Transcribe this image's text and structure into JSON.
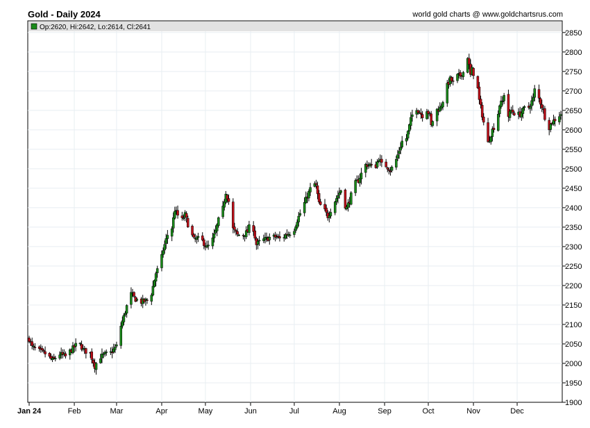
{
  "header": {
    "title": "Gold - Daily 2024",
    "credit": "world gold charts @ www.goldchartsrus.com"
  },
  "legend": {
    "text": "Op:2620, Hi:2642, Lo:2614, Cl:2641",
    "swatch_color": "#1a8a1a"
  },
  "colors": {
    "up": "#1a8a1a",
    "down": "#c0101a",
    "wick": "#000000",
    "grid": "#e8eef2"
  },
  "chart_data": {
    "type": "candlestick",
    "title": "Gold - Daily 2024",
    "ylim": [
      1900,
      2880
    ],
    "yticks": [
      1900,
      1950,
      2000,
      2050,
      2100,
      2150,
      2200,
      2250,
      2300,
      2350,
      2400,
      2450,
      2500,
      2550,
      2600,
      2650,
      2700,
      2750,
      2800,
      2850
    ],
    "xlim": [
      1,
      366
    ],
    "xticks": [
      {
        "day": 1,
        "label": "Jan 24"
      },
      {
        "day": 32,
        "label": "Feb"
      },
      {
        "day": 61,
        "label": "Mar"
      },
      {
        "day": 92,
        "label": "Apr"
      },
      {
        "day": 122,
        "label": "May"
      },
      {
        "day": 153,
        "label": "Jun"
      },
      {
        "day": 183,
        "label": "Jul"
      },
      {
        "day": 214,
        "label": "Aug"
      },
      {
        "day": 245,
        "label": "Sep"
      },
      {
        "day": 275,
        "label": "Oct"
      },
      {
        "day": 306,
        "label": "Nov"
      },
      {
        "day": 336,
        "label": "Dec"
      }
    ],
    "grid": true,
    "close_anchors": [
      [
        1,
        2063
      ],
      [
        3,
        2042
      ],
      [
        8,
        2032
      ],
      [
        12,
        2025
      ],
      [
        17,
        2008
      ],
      [
        22,
        2024
      ],
      [
        26,
        2018
      ],
      [
        29,
        2031
      ],
      [
        32,
        2042
      ],
      [
        35,
        2055
      ],
      [
        38,
        2035
      ],
      [
        43,
        2025
      ],
      [
        46,
        1993
      ],
      [
        49,
        2015
      ],
      [
        53,
        2023
      ],
      [
        57,
        2027
      ],
      [
        61,
        2044
      ],
      [
        63,
        2085
      ],
      [
        66,
        2120
      ],
      [
        69,
        2160
      ],
      [
        71,
        2178
      ],
      [
        74,
        2165
      ],
      [
        78,
        2158
      ],
      [
        82,
        2162
      ],
      [
        85,
        2180
      ],
      [
        88,
        2232
      ],
      [
        91,
        2255
      ],
      [
        93,
        2292
      ],
      [
        96,
        2330
      ],
      [
        99,
        2348
      ],
      [
        101,
        2395
      ],
      [
        103,
        2380
      ],
      [
        105,
        2362
      ],
      [
        108,
        2382
      ],
      [
        111,
        2345
      ],
      [
        114,
        2318
      ],
      [
        117,
        2320
      ],
      [
        120,
        2314
      ],
      [
        123,
        2298
      ],
      [
        126,
        2308
      ],
      [
        129,
        2339
      ],
      [
        131,
        2368
      ],
      [
        134,
        2398
      ],
      [
        136,
        2440
      ],
      [
        138,
        2416
      ],
      [
        141,
        2345
      ],
      [
        144,
        2330
      ],
      [
        148,
        2330
      ],
      [
        151,
        2339
      ],
      [
        153,
        2360
      ],
      [
        155,
        2345
      ],
      [
        157,
        2305
      ],
      [
        160,
        2315
      ],
      [
        164,
        2320
      ],
      [
        167,
        2325
      ],
      [
        171,
        2325
      ],
      [
        174,
        2318
      ],
      [
        177,
        2330
      ],
      [
        180,
        2335
      ],
      [
        183,
        2345
      ],
      [
        185,
        2368
      ],
      [
        188,
        2394
      ],
      [
        192,
        2430
      ],
      [
        196,
        2466
      ],
      [
        198,
        2456
      ],
      [
        200,
        2410
      ],
      [
        203,
        2398
      ],
      [
        206,
        2378
      ],
      [
        210,
        2410
      ],
      [
        213,
        2432
      ],
      [
        215,
        2445
      ],
      [
        217,
        2410
      ],
      [
        219,
        2400
      ],
      [
        221,
        2418
      ],
      [
        224,
        2460
      ],
      [
        227,
        2470
      ],
      [
        230,
        2496
      ],
      [
        232,
        2510
      ],
      [
        235,
        2510
      ],
      [
        238,
        2498
      ],
      [
        241,
        2527
      ],
      [
        244,
        2503
      ],
      [
        246,
        2508
      ],
      [
        249,
        2497
      ],
      [
        252,
        2512
      ],
      [
        255,
        2547
      ],
      [
        258,
        2582
      ],
      [
        260,
        2578
      ],
      [
        263,
        2626
      ],
      [
        266,
        2662
      ],
      [
        268,
        2650
      ],
      [
        271,
        2637
      ],
      [
        274,
        2652
      ],
      [
        276,
        2637
      ],
      [
        277,
        2610
      ],
      [
        280,
        2650
      ],
      [
        283,
        2655
      ],
      [
        285,
        2675
      ],
      [
        287,
        2705
      ],
      [
        290,
        2730
      ],
      [
        292,
        2722
      ],
      [
        295,
        2738
      ],
      [
        297,
        2740
      ],
      [
        301,
        2755
      ],
      [
        302,
        2788
      ],
      [
        304,
        2740
      ],
      [
        305,
        2755
      ],
      [
        306,
        2745
      ],
      [
        307,
        2725
      ],
      [
        309,
        2705
      ],
      [
        310,
        2675
      ],
      [
        311,
        2658
      ],
      [
        314,
        2600
      ],
      [
        316,
        2566
      ],
      [
        319,
        2600
      ],
      [
        322,
        2620
      ],
      [
        324,
        2665
      ],
      [
        326,
        2672
      ],
      [
        328,
        2712
      ],
      [
        330,
        2635
      ],
      [
        332,
        2650
      ],
      [
        335,
        2640
      ],
      [
        338,
        2640
      ],
      [
        341,
        2655
      ],
      [
        344,
        2658
      ],
      [
        347,
        2680
      ],
      [
        349,
        2725
      ],
      [
        351,
        2680
      ],
      [
        354,
        2650
      ],
      [
        357,
        2600
      ],
      [
        360,
        2620
      ],
      [
        363,
        2630
      ],
      [
        366,
        2641
      ]
    ]
  }
}
